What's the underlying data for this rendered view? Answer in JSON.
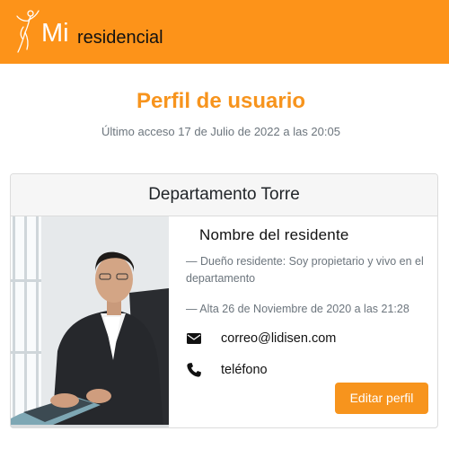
{
  "brand": {
    "mi": "Mi",
    "residencial": "residencial",
    "logo_icon": "dancer-logo-icon"
  },
  "header": {
    "title": "Perfil de usuario",
    "last_access": "Último acceso 17 de Julio de 2022 a las 20:05"
  },
  "card": {
    "title": "Departamento Torre",
    "photo": "resident-photo",
    "resident_name": "Nombre del residente",
    "role": "— Dueño residente: Soy propietario y vivo en el departamento",
    "since": "— Alta 26 de Noviembre de 2020 a las 21:28",
    "email": {
      "icon": "envelope-icon",
      "value": "correo@lidisen.com"
    },
    "phone": {
      "icon": "phone-icon",
      "value": "teléfono"
    },
    "edit_label": "Editar perfil"
  },
  "colors": {
    "accent": "#fd9319",
    "title": "#f7941d",
    "muted": "#6c757d",
    "card_header": "#f6f6f6"
  }
}
